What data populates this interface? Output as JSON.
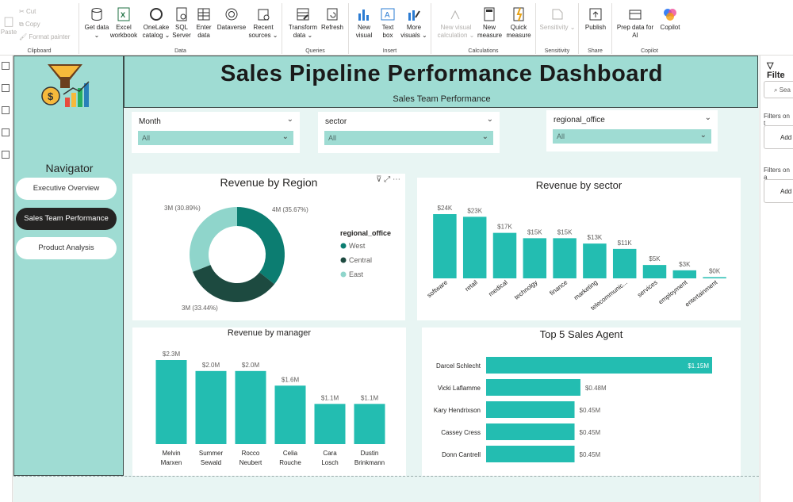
{
  "ribbon": {
    "clipboard": {
      "paste": "Paste",
      "cut": "Cut",
      "copy": "Copy",
      "format_painter": "Format painter",
      "group": "Clipboard"
    },
    "data": {
      "get_data": "Get data ⌄",
      "excel": "Excel workbook",
      "onelake": "OneLake catalog ⌄",
      "sql": "SQL Server",
      "enter": "Enter data",
      "dataverse": "Dataverse",
      "recent": "Recent sources ⌄",
      "group": "Data"
    },
    "queries": {
      "transform": "Transform data ⌄",
      "refresh": "Refresh",
      "group": "Queries"
    },
    "insert": {
      "new_visual": "New visual",
      "text_box": "Text box",
      "more_visuals": "More visuals ⌄",
      "group": "Insert"
    },
    "calculations": {
      "new_visual_calc": "New visual calculation ⌄",
      "new_measure": "New measure",
      "quick_measure": "Quick measure",
      "group": "Calculations"
    },
    "sensitivity": {
      "label": "Sensitivity ⌄",
      "group": "Sensitivity"
    },
    "share": {
      "publish": "Publish",
      "group": "Share"
    },
    "copilot": {
      "prep": "Prep data for AI",
      "copilot": "Copilot",
      "group": "Copilot"
    }
  },
  "header": {
    "title": "Sales Pipeline Performance Dashboard",
    "subtitle": "Sales Team Performance"
  },
  "navigator": {
    "title": "Navigator",
    "items": [
      {
        "label": "Executive Overview",
        "active": false
      },
      {
        "label": "Sales Team Performance",
        "active": true
      },
      {
        "label": "Product Analysis",
        "active": false
      }
    ]
  },
  "slicers": [
    {
      "label": "Month",
      "value": "All"
    },
    {
      "label": "sector",
      "value": "All"
    },
    {
      "label": "regional_office",
      "value": "All"
    }
  ],
  "filters_pane": {
    "title": "Filte",
    "search_placeholder": "Sea",
    "on_page": "Filters on t",
    "on_all": "Filters on a",
    "add": "Add"
  },
  "colors": {
    "teal": "#23bdb1",
    "light_teal": "#9fdcd3",
    "dark_teal": "#0c7d71",
    "dark_green": "#1d4a40",
    "mid_teal": "#8fd5cb"
  },
  "chart_data": [
    {
      "id": "revenue_by_region",
      "type": "pie",
      "title": "Revenue by Region",
      "legend_title": "regional_office",
      "legend_position": "right",
      "slices": [
        {
          "name": "West",
          "label": "4M (35.67%)",
          "percent": 35.67,
          "color": "#0c7d71"
        },
        {
          "name": "Central",
          "label": "3M (33.44%)",
          "percent": 33.44,
          "color": "#1d4a40"
        },
        {
          "name": "East",
          "label": "3M (30.89%)",
          "percent": 30.89,
          "color": "#8fd5cb"
        }
      ]
    },
    {
      "id": "revenue_by_sector",
      "type": "bar",
      "title": "Revenue by sector",
      "categories": [
        "software",
        "retail",
        "medical",
        "technolgy",
        "finance",
        "marketing",
        "telecommunic...",
        "services",
        "employment",
        "entertainment"
      ],
      "values": [
        24,
        23,
        17,
        15,
        15,
        13,
        11,
        5,
        3,
        0.3
      ],
      "labels": [
        "$24K",
        "$23K",
        "$17K",
        "$15K",
        "$15K",
        "$13K",
        "$11K",
        "$5K",
        "$3K",
        "$0K"
      ],
      "ylim": [
        0,
        24
      ]
    },
    {
      "id": "revenue_by_manager",
      "type": "bar",
      "title": "Revenue by manager",
      "categories": [
        "Melvin Marxen",
        "Summer Sewald",
        "Rocco Neubert",
        "Celia Rouche",
        "Cara Losch",
        "Dustin Brinkmann"
      ],
      "values": [
        2.3,
        2.0,
        2.0,
        1.6,
        1.1,
        1.1
      ],
      "labels": [
        "$2.3M",
        "$2.0M",
        "$2.0M",
        "$1.6M",
        "$1.1M",
        "$1.1M"
      ],
      "ylim": [
        0,
        2.3
      ]
    },
    {
      "id": "top5_agents",
      "type": "bar",
      "orientation": "horizontal",
      "title": "Top 5 Sales Agent",
      "categories": [
        "Darcel Schlecht",
        "Vicki Laflamme",
        "Kary Hendrixson",
        "Cassey Cress",
        "Donn Cantrell"
      ],
      "values": [
        1.15,
        0.48,
        0.45,
        0.45,
        0.45
      ],
      "labels": [
        "$1.15M",
        "$0.48M",
        "$0.45M",
        "$0.45M",
        "$0.45M"
      ]
    }
  ]
}
